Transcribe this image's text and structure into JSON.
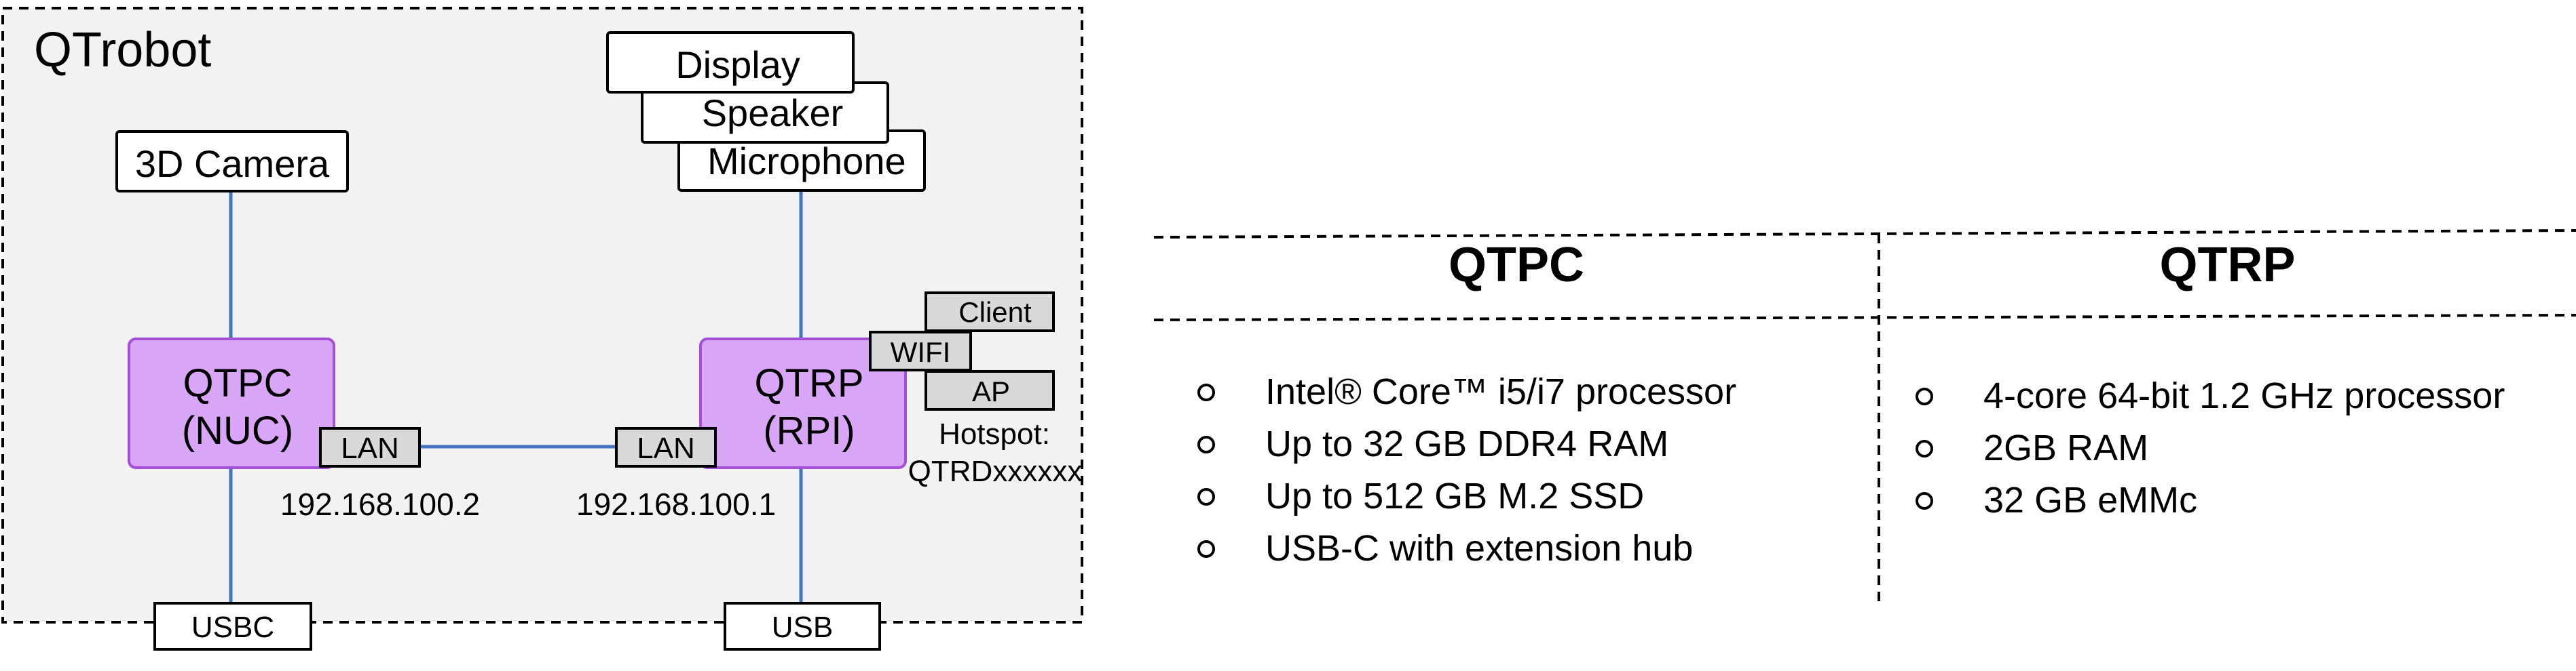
{
  "diagram": {
    "title": "QTrobot",
    "camera": "3D Camera",
    "display": "Display",
    "speaker": "Speaker",
    "microphone": "Microphone",
    "qtpc_line1": "QTPC",
    "qtpc_line2": "(NUC)",
    "qtrp_line1": "QTRP",
    "qtrp_line2": "(RPI)",
    "lan_left": "LAN",
    "lan_right": "LAN",
    "ip_left": "192.168.100.2",
    "ip_right": "192.168.100.1",
    "wifi": "WIFI",
    "client": "Client",
    "ap": "AP",
    "hotspot_line1": "Hotspot:",
    "hotspot_line2": "QTRDxxxxxx",
    "usbc": "USBC",
    "usb": "USB",
    "colors": {
      "module_fill": "#d9a5f7",
      "module_border": "#a44fd8",
      "connector": "#4472c4",
      "panel_bg": "#f2f2f2",
      "port_fill": "#d9d9d9"
    }
  },
  "specs": {
    "qtpc": {
      "title": "QTPC",
      "items": [
        "Intel® Core™ i5/i7 processor",
        "Up to 32 GB DDR4 RAM",
        "Up to 512 GB M.2 SSD",
        "USB-C with extension hub"
      ]
    },
    "qtrp": {
      "title": "QTRP",
      "items": [
        "4-core 64-bit 1.2 GHz processor",
        "2GB RAM",
        "32 GB eMMc"
      ]
    }
  }
}
